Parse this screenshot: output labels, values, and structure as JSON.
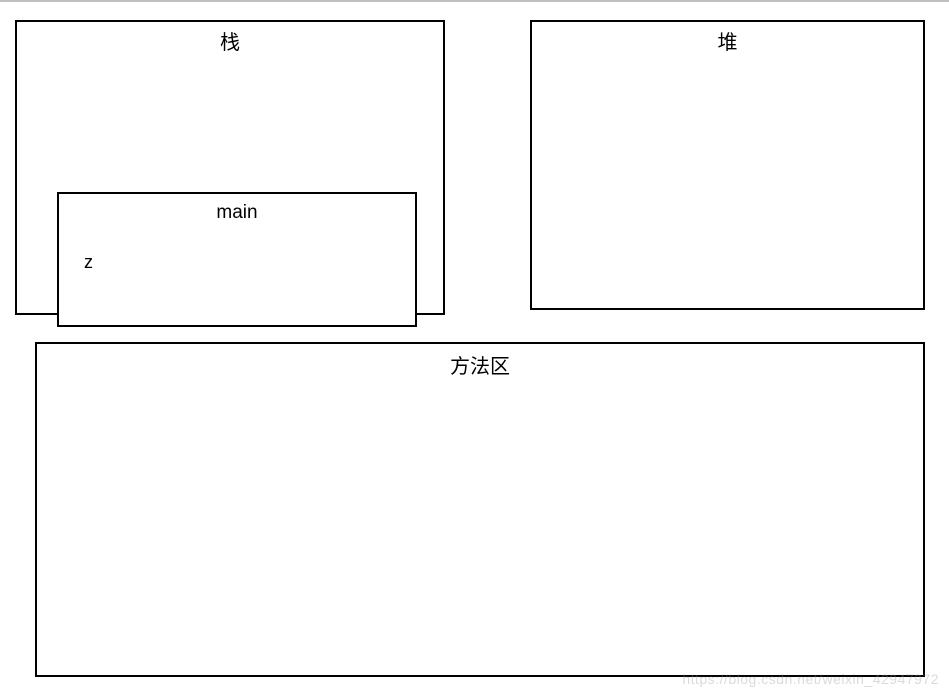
{
  "stack": {
    "title": "栈",
    "frame": {
      "name": "main",
      "variable": "z"
    }
  },
  "heap": {
    "title": "堆"
  },
  "method_area": {
    "title": "方法区"
  },
  "watermark": "https://blog.csdn.net/weixin_42947972"
}
